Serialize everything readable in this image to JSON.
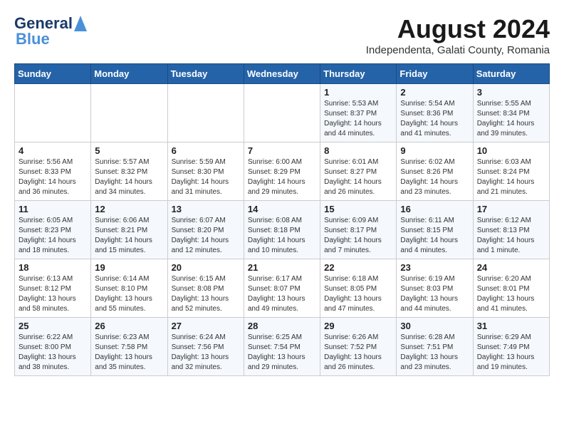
{
  "logo": {
    "line1": "General",
    "line2": "Blue"
  },
  "title": "August 2024",
  "subtitle": "Independenta, Galati County, Romania",
  "days_of_week": [
    "Sunday",
    "Monday",
    "Tuesday",
    "Wednesday",
    "Thursday",
    "Friday",
    "Saturday"
  ],
  "weeks": [
    [
      {
        "day": "",
        "info": ""
      },
      {
        "day": "",
        "info": ""
      },
      {
        "day": "",
        "info": ""
      },
      {
        "day": "",
        "info": ""
      },
      {
        "day": "1",
        "info": "Sunrise: 5:53 AM\nSunset: 8:37 PM\nDaylight: 14 hours and 44 minutes."
      },
      {
        "day": "2",
        "info": "Sunrise: 5:54 AM\nSunset: 8:36 PM\nDaylight: 14 hours and 41 minutes."
      },
      {
        "day": "3",
        "info": "Sunrise: 5:55 AM\nSunset: 8:34 PM\nDaylight: 14 hours and 39 minutes."
      }
    ],
    [
      {
        "day": "4",
        "info": "Sunrise: 5:56 AM\nSunset: 8:33 PM\nDaylight: 14 hours and 36 minutes."
      },
      {
        "day": "5",
        "info": "Sunrise: 5:57 AM\nSunset: 8:32 PM\nDaylight: 14 hours and 34 minutes."
      },
      {
        "day": "6",
        "info": "Sunrise: 5:59 AM\nSunset: 8:30 PM\nDaylight: 14 hours and 31 minutes."
      },
      {
        "day": "7",
        "info": "Sunrise: 6:00 AM\nSunset: 8:29 PM\nDaylight: 14 hours and 29 minutes."
      },
      {
        "day": "8",
        "info": "Sunrise: 6:01 AM\nSunset: 8:27 PM\nDaylight: 14 hours and 26 minutes."
      },
      {
        "day": "9",
        "info": "Sunrise: 6:02 AM\nSunset: 8:26 PM\nDaylight: 14 hours and 23 minutes."
      },
      {
        "day": "10",
        "info": "Sunrise: 6:03 AM\nSunset: 8:24 PM\nDaylight: 14 hours and 21 minutes."
      }
    ],
    [
      {
        "day": "11",
        "info": "Sunrise: 6:05 AM\nSunset: 8:23 PM\nDaylight: 14 hours and 18 minutes."
      },
      {
        "day": "12",
        "info": "Sunrise: 6:06 AM\nSunset: 8:21 PM\nDaylight: 14 hours and 15 minutes."
      },
      {
        "day": "13",
        "info": "Sunrise: 6:07 AM\nSunset: 8:20 PM\nDaylight: 14 hours and 12 minutes."
      },
      {
        "day": "14",
        "info": "Sunrise: 6:08 AM\nSunset: 8:18 PM\nDaylight: 14 hours and 10 minutes."
      },
      {
        "day": "15",
        "info": "Sunrise: 6:09 AM\nSunset: 8:17 PM\nDaylight: 14 hours and 7 minutes."
      },
      {
        "day": "16",
        "info": "Sunrise: 6:11 AM\nSunset: 8:15 PM\nDaylight: 14 hours and 4 minutes."
      },
      {
        "day": "17",
        "info": "Sunrise: 6:12 AM\nSunset: 8:13 PM\nDaylight: 14 hours and 1 minute."
      }
    ],
    [
      {
        "day": "18",
        "info": "Sunrise: 6:13 AM\nSunset: 8:12 PM\nDaylight: 13 hours and 58 minutes."
      },
      {
        "day": "19",
        "info": "Sunrise: 6:14 AM\nSunset: 8:10 PM\nDaylight: 13 hours and 55 minutes."
      },
      {
        "day": "20",
        "info": "Sunrise: 6:15 AM\nSunset: 8:08 PM\nDaylight: 13 hours and 52 minutes."
      },
      {
        "day": "21",
        "info": "Sunrise: 6:17 AM\nSunset: 8:07 PM\nDaylight: 13 hours and 49 minutes."
      },
      {
        "day": "22",
        "info": "Sunrise: 6:18 AM\nSunset: 8:05 PM\nDaylight: 13 hours and 47 minutes."
      },
      {
        "day": "23",
        "info": "Sunrise: 6:19 AM\nSunset: 8:03 PM\nDaylight: 13 hours and 44 minutes."
      },
      {
        "day": "24",
        "info": "Sunrise: 6:20 AM\nSunset: 8:01 PM\nDaylight: 13 hours and 41 minutes."
      }
    ],
    [
      {
        "day": "25",
        "info": "Sunrise: 6:22 AM\nSunset: 8:00 PM\nDaylight: 13 hours and 38 minutes."
      },
      {
        "day": "26",
        "info": "Sunrise: 6:23 AM\nSunset: 7:58 PM\nDaylight: 13 hours and 35 minutes."
      },
      {
        "day": "27",
        "info": "Sunrise: 6:24 AM\nSunset: 7:56 PM\nDaylight: 13 hours and 32 minutes."
      },
      {
        "day": "28",
        "info": "Sunrise: 6:25 AM\nSunset: 7:54 PM\nDaylight: 13 hours and 29 minutes."
      },
      {
        "day": "29",
        "info": "Sunrise: 6:26 AM\nSunset: 7:52 PM\nDaylight: 13 hours and 26 minutes."
      },
      {
        "day": "30",
        "info": "Sunrise: 6:28 AM\nSunset: 7:51 PM\nDaylight: 13 hours and 23 minutes."
      },
      {
        "day": "31",
        "info": "Sunrise: 6:29 AM\nSunset: 7:49 PM\nDaylight: 13 hours and 19 minutes."
      }
    ]
  ]
}
